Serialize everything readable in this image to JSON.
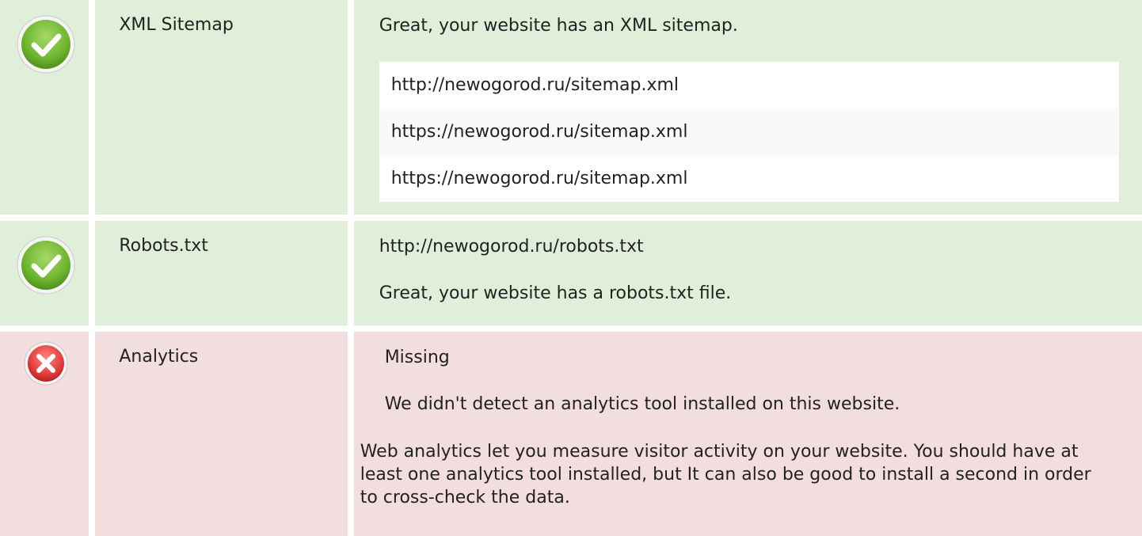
{
  "checks": [
    {
      "status": "pass",
      "name": "XML Sitemap",
      "message": "Great, your website has an XML sitemap.",
      "urls": [
        "http://newogorod.ru/sitemap.xml",
        "https://newogorod.ru/sitemap.xml",
        "https://newogorod.ru/sitemap.xml"
      ]
    },
    {
      "status": "pass",
      "name": "Robots.txt",
      "url": "http://newogorod.ru/robots.txt",
      "message": "Great, your website has a robots.txt file."
    },
    {
      "status": "fail",
      "name": "Analytics",
      "value": "Missing",
      "message": "We didn't detect an analytics tool installed on this website.",
      "description": "Web analytics let you measure visitor activity on your website. You should have at least one analytics tool installed, but It can also be good to install a second in order to cross-check the data."
    }
  ],
  "colors": {
    "pass_bg": "#e0efd9",
    "fail_bg": "#f2dedf",
    "pass_icon": "#6cb52d",
    "fail_icon": "#e23c3c"
  },
  "icons": {
    "pass": "check-circle-icon",
    "fail": "x-circle-icon"
  }
}
